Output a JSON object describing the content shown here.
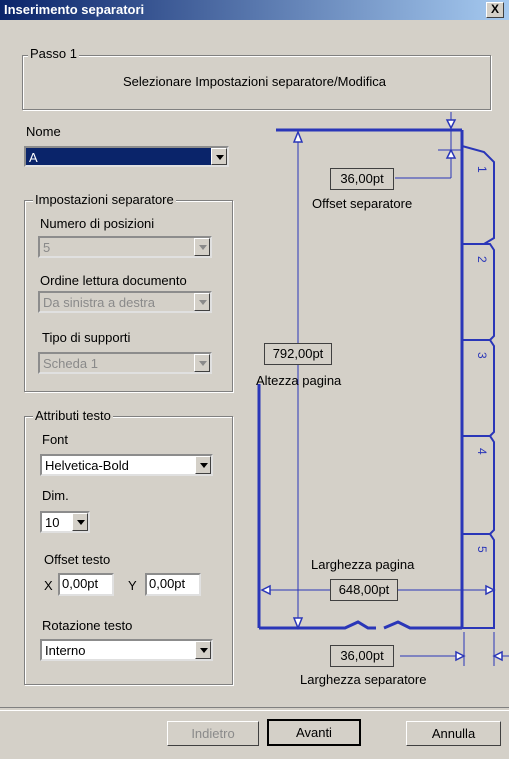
{
  "window": {
    "title": "Inserimento separatori",
    "close_glyph": "X"
  },
  "step": {
    "legend": "Passo 1",
    "instruction": "Selezionare Impostazioni separatore/Modifica"
  },
  "nome": {
    "label": "Nome",
    "value": "A"
  },
  "separator_settings": {
    "legend": "Impostazioni separatore",
    "positions_label": "Numero di posizioni",
    "positions_value": "5",
    "reading_order_label": "Ordine lettura documento",
    "reading_order_value": "Da sinistra a destra",
    "media_type_label": "Tipo di supporti",
    "media_type_value": "Scheda 1"
  },
  "text_attributes": {
    "legend": "Attributi testo",
    "font_label": "Font",
    "font_value": "Helvetica-Bold",
    "size_label": "Dim.",
    "size_value": "10",
    "offset_label": "Offset testo",
    "x_label": "X",
    "x_value": "0,00pt",
    "y_label": "Y",
    "y_value": "0,00pt",
    "rotation_label": "Rotazione testo",
    "rotation_value": "Interno"
  },
  "diagram": {
    "offset_value": "36,00pt",
    "offset_label": "Offset separatore",
    "height_value": "792,00pt",
    "height_label": "Altezza pagina",
    "width_label": "Larghezza pagina",
    "width_value": "648,00pt",
    "sep_width_value": "36,00pt",
    "sep_width_label": "Larghezza separatore",
    "tabs": [
      "1",
      "2",
      "3",
      "4",
      "5"
    ],
    "line_color": "#2a36b8"
  },
  "buttons": {
    "back": "Indietro",
    "next": "Avanti",
    "cancel": "Annulla"
  }
}
